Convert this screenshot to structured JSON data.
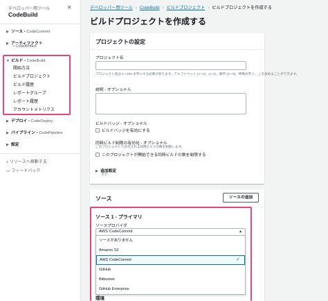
{
  "sidebar": {
    "category": "デベロッパー用ツール",
    "title": "CodeBuild",
    "close_icon": "×",
    "sections": [
      {
        "name": "ソース",
        "sub": "CodeCommit"
      },
      {
        "name": "アーティファクト",
        "sub": "CodeArtifact"
      },
      {
        "name": "ビルド",
        "sub": "CodeBuild"
      },
      {
        "name": "デプロイ",
        "sub": "CodeDeploy"
      },
      {
        "name": "パイプライン",
        "sub": "CodePipeline"
      },
      {
        "name": "設定",
        "sub": ""
      }
    ],
    "build_items": [
      "開始方法",
      "ビルドプロジェクト",
      "ビルド履歴",
      "レポートグループ",
      "レポート履歴",
      "アカウントメトリクス"
    ],
    "links": [
      "リソースへ移動する",
      "フィードバック"
    ]
  },
  "breadcrumbs": [
    "デベロッパー用ツール",
    "CodeBuild",
    "ビルドプロジェクト",
    "ビルドプロジェクトを作成する"
  ],
  "page_title": "ビルドプロジェクトを作成する",
  "project_settings": {
    "heading": "プロジェクトの設定",
    "name_label": "プロジェクト名",
    "name_value": "",
    "name_hint": "プロジェクト名は 2〜255 文字にする必要があります。アルファベット (A〜Z、a〜z)、数字 (0〜9)、特殊文字 (-、_) を含めることができます。",
    "desc_label": "説明 - オプショナル",
    "desc_value": "",
    "badge_label": "ビルドバッジ - オプショナル",
    "badge_checkbox": "ビルドバッジを有効にする",
    "concurrency_label": "同時ビルド制限の有効化 - オプショナル",
    "concurrency_hint": "このプロジェクトで許可される同時ビルドの数を制限します。",
    "concurrency_checkbox": "このプロジェクトが開始できる同時ビルドの数を制限する",
    "additional_label": "追加設定",
    "additional_sub": "タグ"
  },
  "source": {
    "heading": "ソース",
    "add_button": "ソースの追加",
    "primary_heading": "ソース 1 - プライマリ",
    "provider_label": "ソースプロバイダ",
    "selected": "AWS CodeCommit",
    "options": [
      "ソースがありません",
      "Amazon S3",
      "AWS CodeCommit",
      "GitHub",
      "Bitbucket",
      "GitHub Enterprise"
    ],
    "selected_index": 2,
    "next_label": "環境"
  },
  "colors": {
    "highlight": "#e8437b",
    "link": "#0073bb",
    "background": "#f2f3f3"
  }
}
